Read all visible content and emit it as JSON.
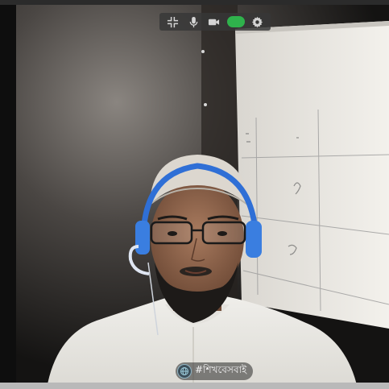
{
  "toolbar": {
    "buttons": [
      {
        "icon": "exit-fullscreen-icon"
      },
      {
        "icon": "microphone-icon"
      },
      {
        "icon": "video-camera-icon"
      },
      {
        "icon": "toggle-icon",
        "color": "#2fb24c"
      },
      {
        "icon": "gear-icon"
      }
    ]
  },
  "caption": {
    "text": "#শিখবেসবাই",
    "logo_icon": "globe-logo-icon"
  },
  "colors": {
    "toggle_active": "#2fb24c",
    "toolbar_bg": "#373737"
  }
}
